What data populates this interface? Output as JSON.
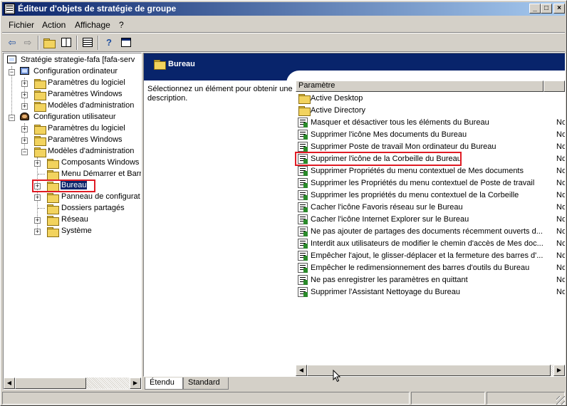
{
  "window": {
    "title": "Éditeur d'objets de stratégie de groupe",
    "controls": {
      "minimize": "_",
      "maximize": "□",
      "close": "×"
    }
  },
  "menu": [
    {
      "label": "Fichier"
    },
    {
      "label": "Action"
    },
    {
      "label": "Affichage"
    },
    {
      "label": "?"
    }
  ],
  "toolbar": {
    "icons": [
      "back-arrow-icon",
      "forward-arrow-icon",
      "up-folder-icon",
      "show-hide-tree-icon",
      "export-list-icon",
      "help-icon",
      "properties-icon"
    ]
  },
  "tree": {
    "root": "Stratégie strategie-fafa [fafa-serv",
    "computer_config": "Configuration ordinateur",
    "computer_children": [
      "Paramètres du logiciel",
      "Paramètres Windows",
      "Modèles d'administration"
    ],
    "user_config": "Configuration utilisateur",
    "user_children": [
      "Paramètres du logiciel",
      "Paramètres Windows",
      "Modèles d'administration"
    ],
    "admin_templates_children": [
      "Composants Windows",
      "Menu Démarrer et Barr",
      "Bureau",
      "Panneau de configurat",
      "Dossiers partagés",
      "Réseau",
      "Système"
    ],
    "selected": "Bureau"
  },
  "right": {
    "header_title": "Bureau",
    "description": "Sélectionnez un élément pour obtenir une description.",
    "column_name": "Paramètre",
    "column_state": "",
    "folders": [
      "Active Desktop",
      "Active Directory"
    ],
    "policies": [
      {
        "name": "Masquer et désactiver tous les éléments du Bureau",
        "state": "Non"
      },
      {
        "name": "Supprimer l'icône Mes documents du Bureau",
        "state": "Non"
      },
      {
        "name": "Supprimer Poste de travail Mon ordinateur du Bureau",
        "state": "Non"
      },
      {
        "name": "Supprimer l'icône de la Corbeille du Bureau",
        "state": "Non"
      },
      {
        "name": "Supprimer Propriétés du menu contextuel de Mes documents",
        "state": "Non"
      },
      {
        "name": "Supprimer les Propriétés du menu contextuel de Poste de travail",
        "state": "Non"
      },
      {
        "name": "Supprimer les propriétés du menu contextuel de la Corbeille",
        "state": "Non"
      },
      {
        "name": "Cacher l'icône Favoris réseau sur le Bureau",
        "state": "Non"
      },
      {
        "name": "Cacher l'icône Internet Explorer sur le Bureau",
        "state": "Non"
      },
      {
        "name": "Ne pas ajouter de partages des documents récemment ouverts d...",
        "state": "Non"
      },
      {
        "name": "Interdit aux utilisateurs de modifier le chemin d'accès de Mes doc...",
        "state": "Non"
      },
      {
        "name": "Empêcher l'ajout, le glisser-déplacer et la fermeture des barres d'...",
        "state": "Non"
      },
      {
        "name": "Empêcher le redimensionnement des barres d'outils du Bureau",
        "state": "Non"
      },
      {
        "name": "Ne pas enregistrer les paramètres en quittant",
        "state": "Non"
      },
      {
        "name": "Supprimer l'Assistant Nettoyage du Bureau",
        "state": "Non"
      }
    ],
    "highlighted_policy": "Supprimer l'icône de la Corbeille du Bureau"
  },
  "tabs": [
    {
      "label": "Étendu",
      "active": true
    },
    {
      "label": "Standard",
      "active": false
    }
  ]
}
